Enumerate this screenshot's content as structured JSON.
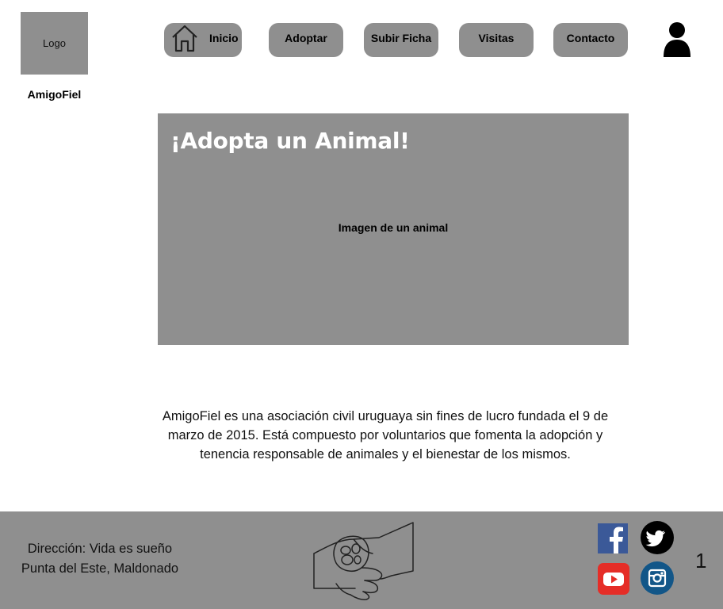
{
  "header": {
    "logo_text": "Logo",
    "brand_name": "AmigoFiel",
    "nav": {
      "inicio": "Inicio",
      "adoptar": "Adoptar",
      "subir_ficha": "Subir Ficha",
      "visitas": "Visitas",
      "contacto": "Contacto"
    },
    "icons": {
      "home": "home-icon",
      "user": "user-icon"
    }
  },
  "hero": {
    "title": "¡Adopta un Animal!",
    "image_caption": "Imagen de un animal"
  },
  "about": {
    "text": "AmigoFiel es una asociación civil uruguaya sin fines de lucro fundada el 9 de marzo de 2015. Está compuesto por voluntarios que fomenta la adopción y tenencia responsable de animales y el bienestar de los mismos."
  },
  "footer": {
    "address_line1": "Dirección: Vida es sueño",
    "address_line2": "Punta del Este, Maldonado",
    "page_number": "1",
    "social": [
      "facebook-icon",
      "twitter-icon",
      "youtube-icon",
      "instagram-icon"
    ]
  },
  "colors": {
    "placeholder_gray": "#8f8f8f",
    "facebook": "#3b5998",
    "twitter": "#000000",
    "youtube": "#e52d27",
    "instagram": "#125688"
  }
}
